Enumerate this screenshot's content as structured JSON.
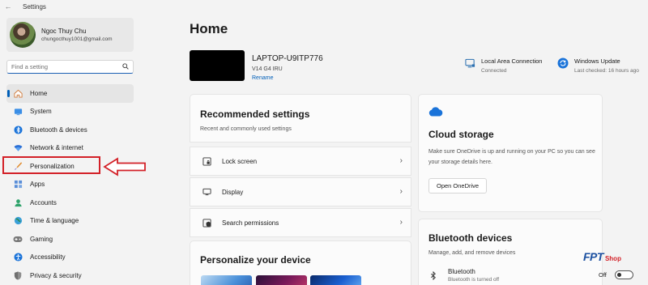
{
  "window": {
    "title": "Settings"
  },
  "profile": {
    "name": "Ngoc Thuy Chu",
    "email": "chungocthuy1001@gmail.com"
  },
  "search": {
    "placeholder": "Find a setting"
  },
  "nav": [
    {
      "label": "Home",
      "icon": "home-icon"
    },
    {
      "label": "System",
      "icon": "system-icon"
    },
    {
      "label": "Bluetooth & devices",
      "icon": "bluetooth-icon"
    },
    {
      "label": "Network & internet",
      "icon": "wifi-icon"
    },
    {
      "label": "Personalization",
      "icon": "brush-icon"
    },
    {
      "label": "Apps",
      "icon": "apps-icon"
    },
    {
      "label": "Accounts",
      "icon": "accounts-icon"
    },
    {
      "label": "Time & language",
      "icon": "globe-icon"
    },
    {
      "label": "Gaming",
      "icon": "gamepad-icon"
    },
    {
      "label": "Accessibility",
      "icon": "accessibility-icon"
    },
    {
      "label": "Privacy & security",
      "icon": "shield-icon"
    }
  ],
  "main": {
    "title": "Home",
    "device": {
      "name": "LAPTOP-U9ITP776",
      "model": "V14 G4 IRU",
      "rename": "Rename"
    },
    "network": {
      "title": "Local Area Connection",
      "status": "Connected"
    },
    "update": {
      "title": "Windows Update",
      "status": "Last checked: 16 hours ago"
    },
    "recommended": {
      "title": "Recommended settings",
      "subtitle": "Recent and commonly used settings",
      "items": [
        {
          "label": "Lock screen",
          "icon": "lock-screen-icon"
        },
        {
          "label": "Display",
          "icon": "display-icon"
        },
        {
          "label": "Search permissions",
          "icon": "search-permissions-icon"
        }
      ]
    },
    "personalize": {
      "title": "Personalize your device"
    },
    "cloud": {
      "title": "Cloud storage",
      "description": "Make sure OneDrive is up and running on your PC so you can see your storage details here.",
      "button": "Open OneDrive"
    },
    "bluetooth": {
      "title": "Bluetooth devices",
      "subtitle": "Manage, add, and remove devices",
      "item_title": "Bluetooth",
      "item_status": "Bluetooth is turned off",
      "toggle_label": "Off"
    }
  },
  "watermark": {
    "brand": "FPT",
    "suffix": "Shop"
  },
  "colors": {
    "accent": "#005fb8",
    "highlight": "#d32027"
  }
}
